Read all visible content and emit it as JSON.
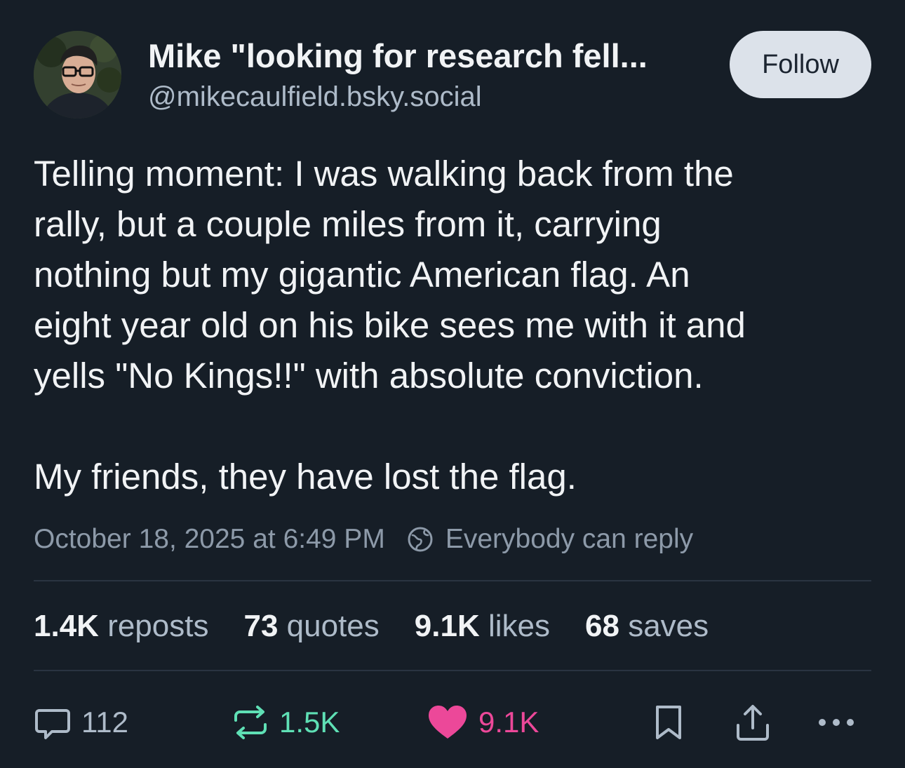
{
  "author": {
    "display_name": "Mike \"looking for research fell...",
    "handle": "@mikecaulfield.bsky.social",
    "avatar_icon": "person-avatar-photo"
  },
  "follow_label": "Follow",
  "post": {
    "lines_p1": [
      "Telling moment: I was walking back from the",
      "rally, but a couple miles from it, carrying",
      "nothing but my gigantic American flag. An",
      "eight year old on his bike sees me with it and",
      "yells \"No Kings!!\" with absolute conviction."
    ],
    "line_p2": "My friends, they have lost the flag."
  },
  "meta": {
    "timestamp": "October 18, 2025 at 6:49 PM",
    "reply_setting": "Everybody can reply",
    "reply_setting_icon": "globe-icon"
  },
  "stats": {
    "reposts": {
      "count": "1.4K",
      "label": "reposts"
    },
    "quotes": {
      "count": "73",
      "label": "quotes"
    },
    "likes": {
      "count": "9.1K",
      "label": "likes"
    },
    "saves": {
      "count": "68",
      "label": "saves"
    }
  },
  "actions": {
    "reply_count": "112",
    "repost_count": "1.5K",
    "like_count": "9.1K",
    "icons": [
      "reply-icon",
      "repost-icon",
      "heart-icon",
      "bookmark-icon",
      "share-icon",
      "more-icon"
    ]
  },
  "colors": {
    "background": "#161e27",
    "repost_active": "#5fe0b5",
    "like_active": "#ec4899",
    "follow_button_bg": "#dce2ea"
  }
}
